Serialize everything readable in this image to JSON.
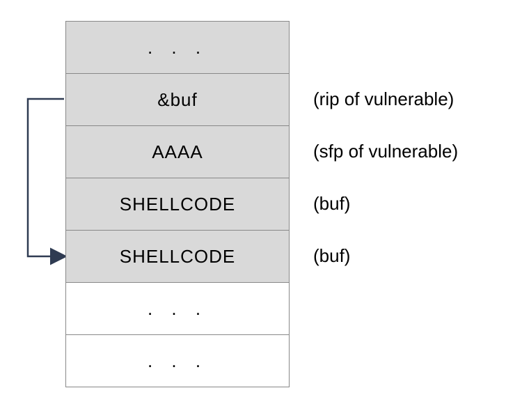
{
  "diagram": {
    "rows": [
      {
        "content": ". . .",
        "annotation": "",
        "filled": true,
        "ellipsis": true
      },
      {
        "content": "&buf",
        "annotation": "(rip of vulnerable)",
        "filled": true,
        "ellipsis": false
      },
      {
        "content": "AAAA",
        "annotation": "(sfp of vulnerable)",
        "filled": true,
        "ellipsis": false
      },
      {
        "content": "SHELLCODE",
        "annotation": "(buf)",
        "filled": true,
        "ellipsis": false
      },
      {
        "content": "SHELLCODE",
        "annotation": "(buf)",
        "filled": true,
        "ellipsis": false
      },
      {
        "content": ". . .",
        "annotation": "",
        "filled": false,
        "ellipsis": true
      },
      {
        "content": ". . .",
        "annotation": "",
        "filled": false,
        "ellipsis": true
      }
    ],
    "arrow": {
      "fromRow": 1,
      "toRow": 4
    }
  }
}
